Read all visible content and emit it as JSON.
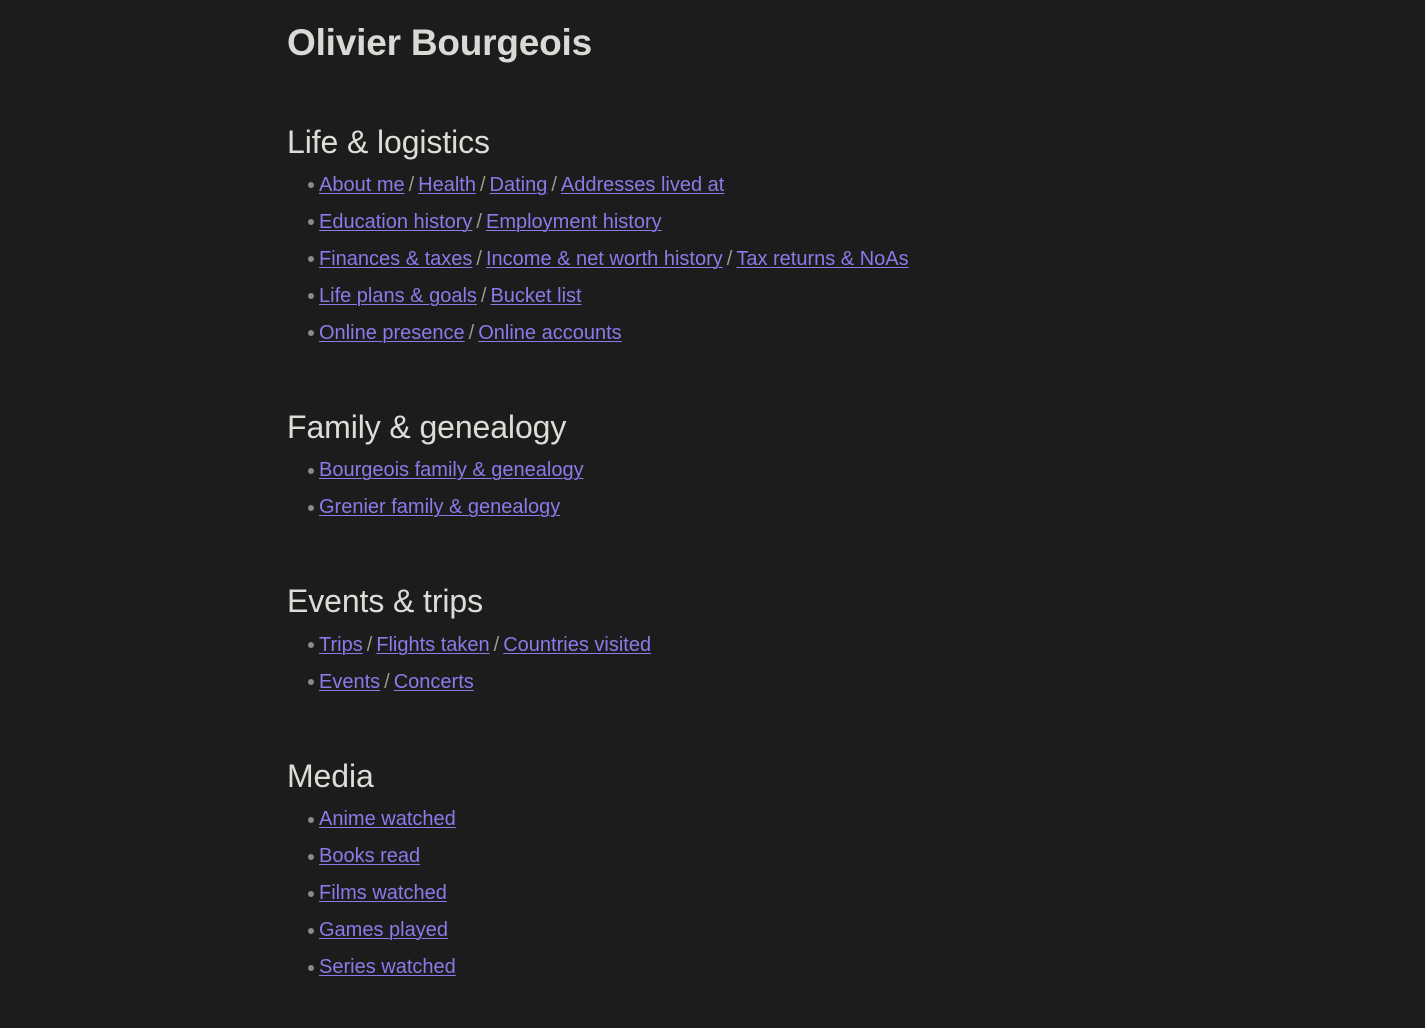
{
  "page": {
    "title": "Olivier Bourgeois",
    "background_color": "#1c1c1c",
    "heading_color": "#ddddd8",
    "link_color": "#8b7ae8",
    "separator_color": "#9a9a95",
    "bullet_color": "#8a8a86",
    "separator_text": "/"
  },
  "sections": [
    {
      "heading": "Life & logistics",
      "rows": [
        {
          "links": [
            "About me",
            "Health",
            "Dating",
            "Addresses lived at"
          ]
        },
        {
          "links": [
            "Education history",
            "Employment history"
          ]
        },
        {
          "links": [
            "Finances & taxes",
            "Income & net worth history",
            "Tax returns & NoAs"
          ]
        },
        {
          "links": [
            "Life plans & goals",
            "Bucket list"
          ]
        },
        {
          "links": [
            "Online presence",
            "Online accounts"
          ]
        }
      ]
    },
    {
      "heading": "Family & genealogy",
      "rows": [
        {
          "links": [
            "Bourgeois family & genealogy"
          ]
        },
        {
          "links": [
            "Grenier family & genealogy"
          ]
        }
      ]
    },
    {
      "heading": "Events & trips",
      "rows": [
        {
          "links": [
            "Trips",
            "Flights taken",
            "Countries visited"
          ]
        },
        {
          "links": [
            "Events",
            "Concerts"
          ]
        }
      ]
    },
    {
      "heading": "Media",
      "rows": [
        {
          "links": [
            "Anime watched"
          ]
        },
        {
          "links": [
            "Books read"
          ]
        },
        {
          "links": [
            "Films watched"
          ]
        },
        {
          "links": [
            "Games played"
          ]
        },
        {
          "links": [
            "Series watched"
          ]
        }
      ]
    }
  ]
}
